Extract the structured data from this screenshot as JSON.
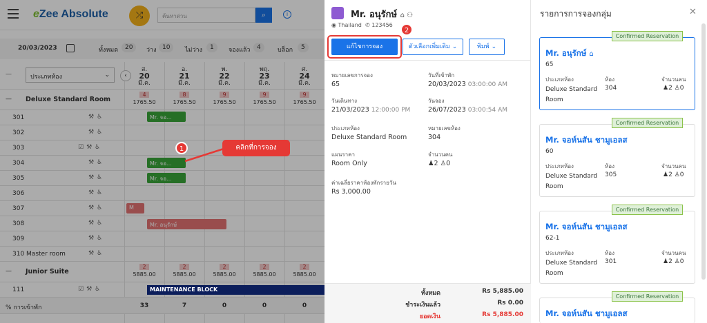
{
  "app": {
    "brand_e": "e",
    "brand_rest": "Zee Absolute",
    "search_placeholder": "ค้นหาด่วน"
  },
  "filters": {
    "date": "20/03/2023",
    "items": [
      {
        "label": "ทั้งหมด",
        "count": "20"
      },
      {
        "label": "ว่าง",
        "count": "10"
      },
      {
        "label": "ไม่ว่าง",
        "count": "1"
      },
      {
        "label": "จองแล้ว",
        "count": "4"
      },
      {
        "label": "บล็อก",
        "count": "5"
      }
    ]
  },
  "grid": {
    "room_type_select": "ประเภทห้อง",
    "days": [
      {
        "dow": "ส.",
        "num": "20",
        "month": "มี.ค."
      },
      {
        "dow": "อ.",
        "num": "21",
        "month": "มี.ค."
      },
      {
        "dow": "พ.",
        "num": "22",
        "month": "มี.ค."
      },
      {
        "dow": "พฤ.",
        "num": "23",
        "month": "มี.ค."
      },
      {
        "dow": "ศ.",
        "num": "24",
        "month": "มี.ค."
      }
    ],
    "section1": {
      "name": "Deluxe Standard Room",
      "avail": [
        "4",
        "8",
        "9",
        "9",
        "9"
      ],
      "prices": [
        "1765.50",
        "1765.50",
        "1765.50",
        "1765.50",
        "1765.50"
      ]
    },
    "rooms": [
      "301",
      "302",
      "303",
      "304",
      "305",
      "306",
      "307",
      "308",
      "309",
      "310 Master room"
    ],
    "section2": {
      "name": "Junior Suite",
      "avail": [
        "2",
        "2",
        "2",
        "2",
        "2"
      ],
      "prices": [
        "5885.00",
        "5885.00",
        "5885.00",
        "5885.00",
        "5885.00"
      ]
    },
    "room111": "111",
    "maintenance": "MAINTENANCE BLOCK",
    "occupancy": {
      "label": "% การเข้าพัก",
      "values": [
        "33",
        "7",
        "0",
        "0",
        "0"
      ]
    },
    "bookings": {
      "b301": "Mr. จอ...",
      "b304": "Mr. จอ...",
      "b305": "Mr. จอ...",
      "b307": "M",
      "b308": "Mr. อนุรักษ์"
    }
  },
  "annotations": {
    "callout": "คลิกที่การจอง",
    "num1": "1",
    "num2": "2"
  },
  "detail": {
    "guest_name": "Mr. อนุรักษ์",
    "country": "Thailand",
    "phone": "123456",
    "edit_button": "แก้ไขการจอง",
    "more_options": "ตัวเลือกเพิ่มเติม",
    "print": "พิมพ์",
    "fields": {
      "res_no_label": "หมายเลขการจอง",
      "res_no": "65",
      "checkin_label": "วันที่เข้าพัก",
      "checkin_date": "20/03/2023",
      "checkin_time": "03:00:00 AM",
      "checkout_label": "วันเดินทาง",
      "checkout_date": "21/03/2023",
      "checkout_time": "12:00:00 PM",
      "booked_label": "วันจอง",
      "booked_date": "26/07/2023",
      "booked_time": "03:00:54 AM",
      "room_type_label": "ประเภทห้อง",
      "room_type": "Deluxe Standard Room",
      "room_no_label": "หมายเลขห้อง",
      "room_no": "304",
      "rate_label": "แผนราคา",
      "rate": "Room Only",
      "pax_label": "จำนวนคน",
      "adults": "2",
      "children": "0",
      "avg_label": "ค่าเฉลี่ยราคาห้องพักรายวัน",
      "avg": "Rs 3,000.00"
    },
    "totals": [
      {
        "label": "ทั้งหมด",
        "value": "Rs 5,885.00",
        "color": "#333333"
      },
      {
        "label": "ชำระเงินแล้ว",
        "value": "Rs 0.00",
        "color": "#333333"
      },
      {
        "label": "ยอดเงิน",
        "value": "Rs 5,885.00",
        "color": "#e53935"
      }
    ]
  },
  "group": {
    "title": "รายการการจองกลุ่ม",
    "cards": [
      {
        "status": "Confirmed Reservation",
        "name": "Mr. อนุรักษ์",
        "id": "65",
        "room_type_h": "ประเภทห้อง",
        "room_h": "ห้อง",
        "pax_h": "จำนวนคน",
        "room_type": "Deluxe Standard",
        "room_type2": "Room",
        "room": "304",
        "adults": "2",
        "children": "0"
      },
      {
        "status": "Confirmed Reservation",
        "name": "Mr. จอห์นสัน ชามูเอลส",
        "id": "60",
        "room_type_h": "ประเภทห้อง",
        "room_h": "ห้อง",
        "pax_h": "จำนวนคน",
        "room_type": "Deluxe Standard",
        "room_type2": "Room",
        "room": "305",
        "adults": "2",
        "children": "0"
      },
      {
        "status": "Confirmed Reservation",
        "name": "Mr. จอห์นสัน ชามูเอลส",
        "id": "62-1",
        "room_type_h": "ประเภทห้อง",
        "room_h": "ห้อง",
        "pax_h": "จำนวนคน",
        "room_type": "Deluxe Standard",
        "room_type2": "Room",
        "room": "301",
        "adults": "2",
        "children": "0"
      },
      {
        "status": "Confirmed Reservation",
        "name": "Mr. จอห์นสัน ชามูเอลส"
      }
    ]
  }
}
